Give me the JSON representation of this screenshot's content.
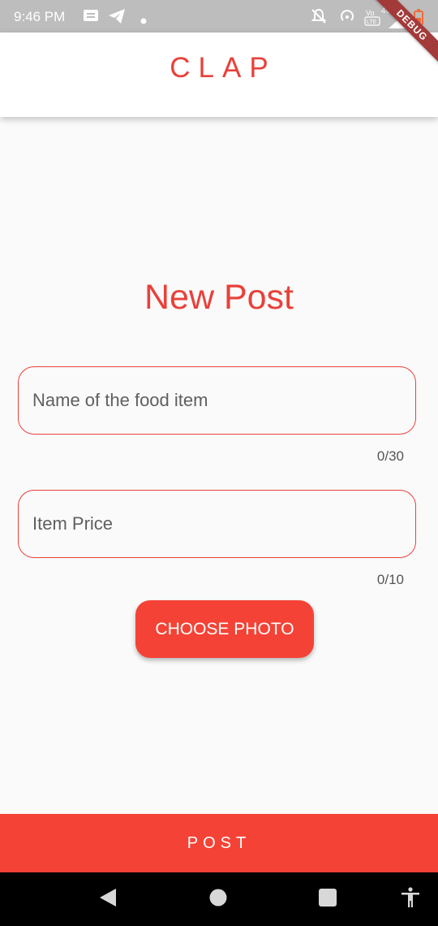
{
  "status_bar": {
    "time": "9:46 PM",
    "icons": [
      "message-icon",
      "telegram-icon",
      "dot-icon",
      "notifications-off-icon",
      "hotspot-icon",
      "volte-icon",
      "network-icon",
      "battery-icon"
    ],
    "network_label": "4G"
  },
  "debug_banner": {
    "label": "DEBUG"
  },
  "app_bar": {
    "title": "CLAP"
  },
  "form": {
    "heading": "New Post",
    "name_field": {
      "placeholder": "Name of the food item",
      "value": "",
      "counter": "0/30"
    },
    "price_field": {
      "placeholder": "Item Price",
      "value": "",
      "counter": "0/10"
    },
    "choose_photo_label": "CHOOSE PHOTO"
  },
  "post_button": {
    "label": "POST"
  },
  "nav_bar": {
    "icons": [
      "back-icon",
      "home-icon",
      "recents-icon",
      "accessibility-icon"
    ]
  },
  "colors": {
    "accent": "#e8413a",
    "button": "#f44336",
    "background": "#fafafa"
  }
}
